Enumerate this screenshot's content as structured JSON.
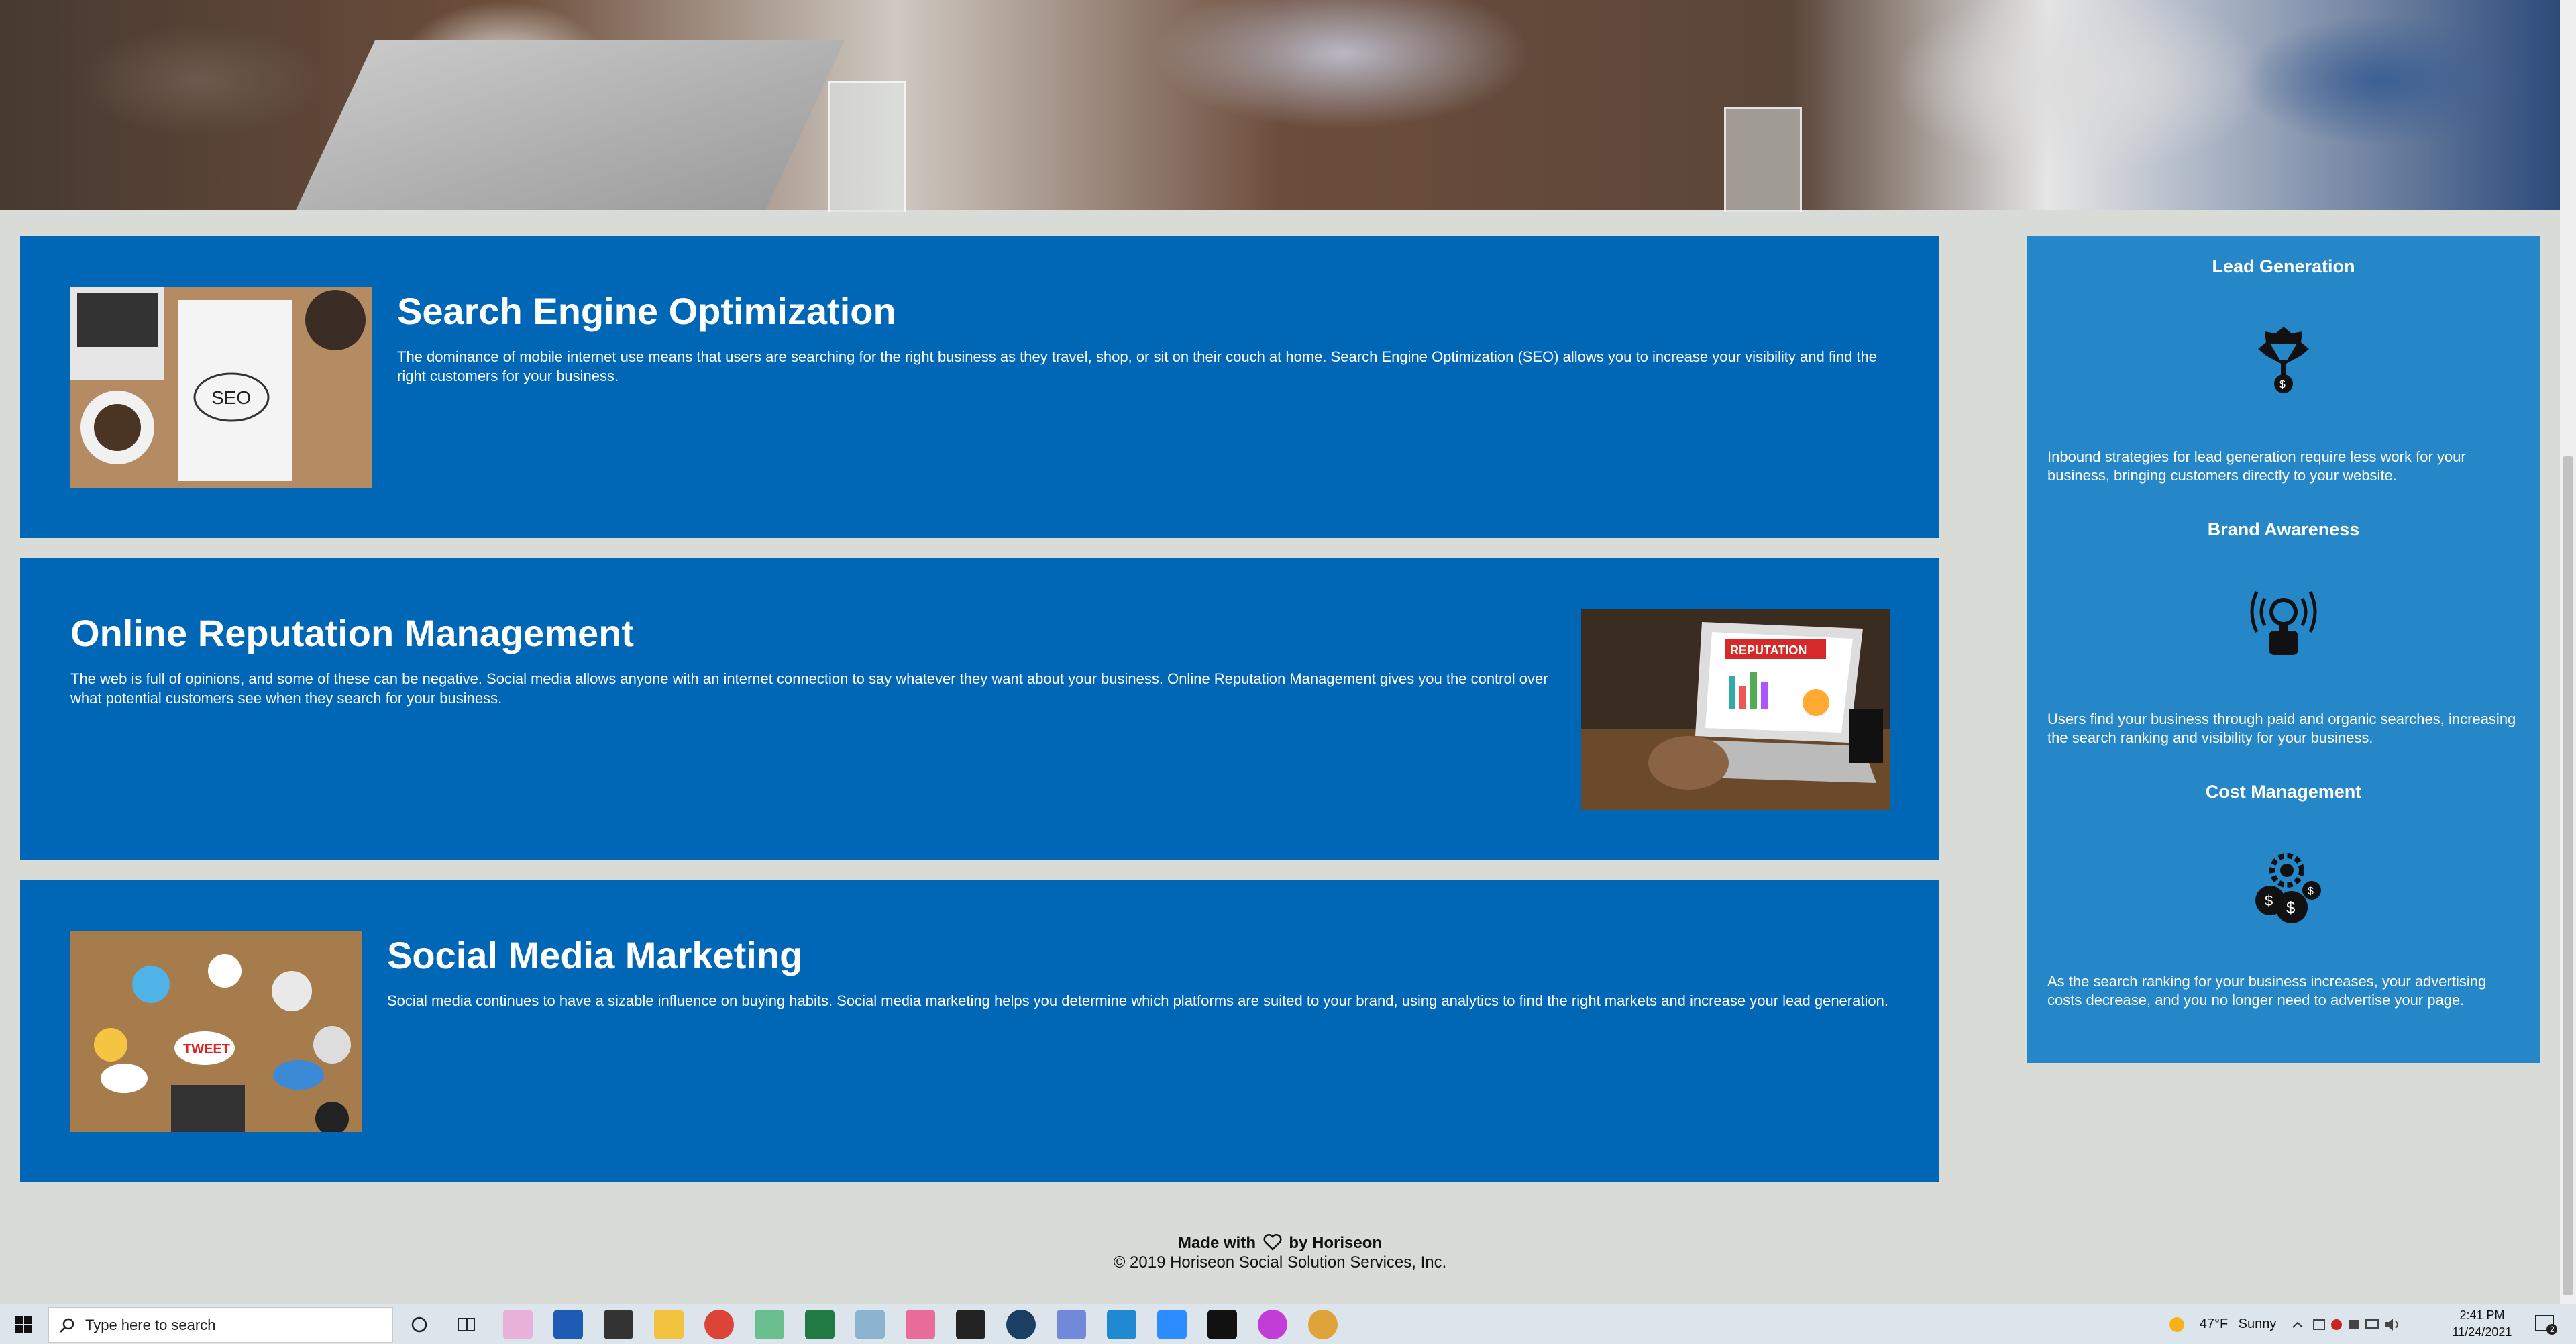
{
  "cards": [
    {
      "title": "Search Engine Optimization",
      "text": "The dominance of mobile internet use means that users are searching for the right business as they travel, shop, or sit on their couch at home. Search Engine Optimization (SEO) allows you to increase your visibility and find the right customers for your business.",
      "image_label": "SEO"
    },
    {
      "title": "Online Reputation Management",
      "text": "The web is full of opinions, and some of these can be negative. Social media allows anyone with an internet connection to say whatever they want about your business. Online Reputation Management gives you the control over what potential customers see when they search for your business.",
      "image_label": "REPUTATION"
    },
    {
      "title": "Social Media Marketing",
      "text": "Social media continues to have a sizable influence on buying habits. Social media marketing helps you determine which platforms are suited to your brand, using analytics to find the right markets and increase your lead generation.",
      "image_label": "TWEET"
    }
  ],
  "benefits": [
    {
      "title": "Lead Generation",
      "icon": "lead-generation-icon",
      "text": "Inbound strategies for lead generation require less work for your business, bringing customers directly to your website."
    },
    {
      "title": "Brand Awareness",
      "icon": "brand-awareness-icon",
      "text": "Users find your business through paid and organic searches, increasing the search ranking and visibility for your business."
    },
    {
      "title": "Cost Management",
      "icon": "cost-management-icon",
      "text": "As the search ranking for your business increases, your advertising costs decrease, and you no longer need to advertise your page."
    }
  ],
  "footer": {
    "made_with_prefix": "Made with",
    "made_with_suffix": "by Horiseon",
    "copyright": "© 2019 Horiseon Social Solution Services, Inc."
  },
  "taskbar": {
    "search_placeholder": "Type here to search",
    "weather_temp": "47°F",
    "weather_text": "Sunny",
    "time": "2:41 PM",
    "date": "11/24/2021",
    "notification_count": "2",
    "colors": {
      "brand_blue": "#0067b7",
      "aside_blue": "#2587c7",
      "background": "#d9dcd6"
    }
  }
}
